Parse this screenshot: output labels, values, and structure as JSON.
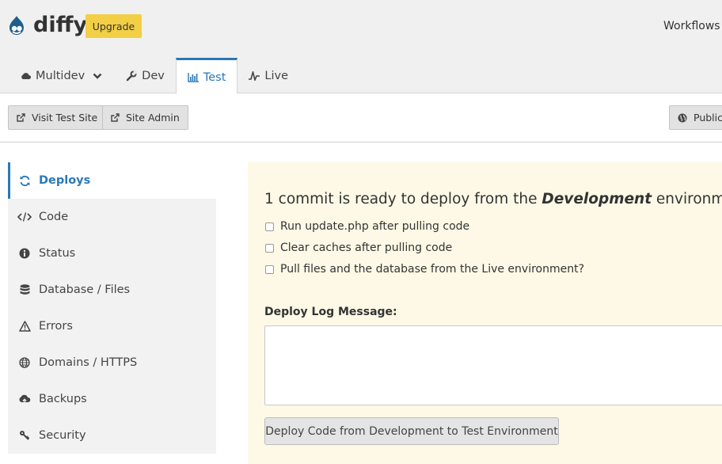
{
  "header": {
    "site_name": "diffy",
    "upgrade_label": "Upgrade",
    "workflows_label": "Workflows",
    "colors": {
      "upgrade": "#f2cf44",
      "accent": "#2a78b8",
      "logo": "#1f5f8f"
    }
  },
  "tabs": [
    {
      "label": "Multidev",
      "icon": "cloud-icon",
      "has_dropdown": true,
      "active": false
    },
    {
      "label": "Dev",
      "icon": "wrench-icon",
      "active": false
    },
    {
      "label": "Test",
      "icon": "bar-chart-icon",
      "active": true
    },
    {
      "label": "Live",
      "icon": "pulse-icon",
      "active": false
    }
  ],
  "actions": {
    "visit_site": {
      "label": "Visit Test Site",
      "icon": "external-link-icon"
    },
    "site_admin": {
      "label": "Site Admin",
      "icon": "external-link-icon"
    },
    "public": {
      "label": "Public",
      "icon": "globe-icon"
    }
  },
  "sidebar": {
    "items": [
      {
        "label": "Deploys",
        "icon": "refresh-icon",
        "active": true
      },
      {
        "label": "Code",
        "icon": "code-icon",
        "active": false
      },
      {
        "label": "Status",
        "icon": "info-icon",
        "active": false
      },
      {
        "label": "Database / Files",
        "icon": "database-icon",
        "active": false
      },
      {
        "label": "Errors",
        "icon": "warning-icon",
        "active": false
      },
      {
        "label": "Domains / HTTPS",
        "icon": "globe-icon",
        "active": false
      },
      {
        "label": "Backups",
        "icon": "cloud-upload-icon",
        "active": false
      },
      {
        "label": "Security",
        "icon": "keys-icon",
        "active": false
      }
    ]
  },
  "deploy_panel": {
    "title_prefix": "1 commit is ready to deploy from the ",
    "title_env": "Development",
    "title_suffix": " environment",
    "options": [
      {
        "label": "Run update.php after pulling code",
        "checked": false
      },
      {
        "label": "Clear caches after pulling code",
        "checked": false
      },
      {
        "label": "Pull files and the database from the Live environment?",
        "checked": false
      }
    ],
    "log_label": "Deploy Log Message:",
    "log_value": "",
    "deploy_button": "Deploy Code from Development to Test Environment"
  }
}
